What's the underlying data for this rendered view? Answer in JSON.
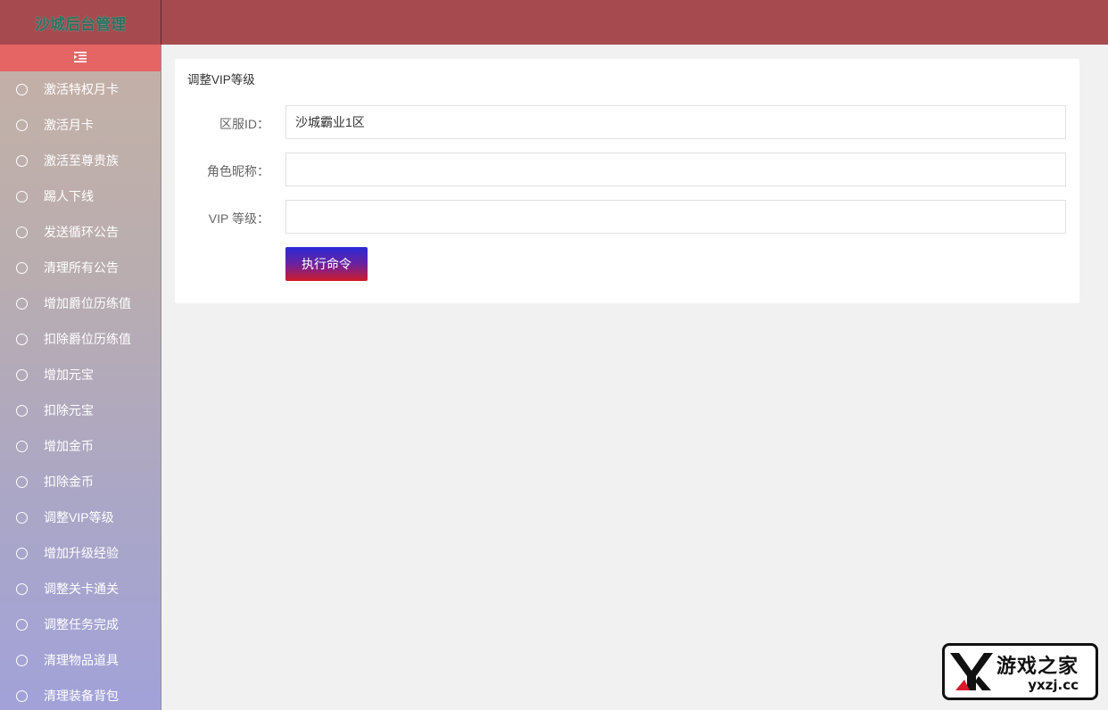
{
  "header": {
    "brand": "沙城后台管理"
  },
  "sidebar": {
    "toggle_icon": "menu-fold-icon",
    "items": [
      {
        "label": "激活特权月卡"
      },
      {
        "label": "激活月卡"
      },
      {
        "label": "激活至尊贵族"
      },
      {
        "label": "踢人下线"
      },
      {
        "label": "发送循环公告"
      },
      {
        "label": "清理所有公告"
      },
      {
        "label": "增加爵位历练值"
      },
      {
        "label": "扣除爵位历练值"
      },
      {
        "label": "增加元宝"
      },
      {
        "label": "扣除元宝"
      },
      {
        "label": "增加金币"
      },
      {
        "label": "扣除金币"
      },
      {
        "label": "调整VIP等级"
      },
      {
        "label": "增加升级经验"
      },
      {
        "label": "调整关卡通关"
      },
      {
        "label": "调整任务完成"
      },
      {
        "label": "清理物品道具"
      },
      {
        "label": "清理装备背包"
      }
    ]
  },
  "main": {
    "title": "调整VIP等级",
    "fields": [
      {
        "label": "区服ID：",
        "value": "沙城霸业1区"
      },
      {
        "label": "角色昵称：",
        "value": ""
      },
      {
        "label": "VIP 等级：",
        "value": ""
      }
    ],
    "submit_label": "执行命令"
  },
  "watermark": {
    "cn": "游戏之家",
    "en": "yxzj.cc"
  },
  "colors": {
    "header": "#a74a4f",
    "toggle": "#e56565",
    "button_top": "#2a2ad6",
    "button_bottom": "#d11a2a"
  }
}
